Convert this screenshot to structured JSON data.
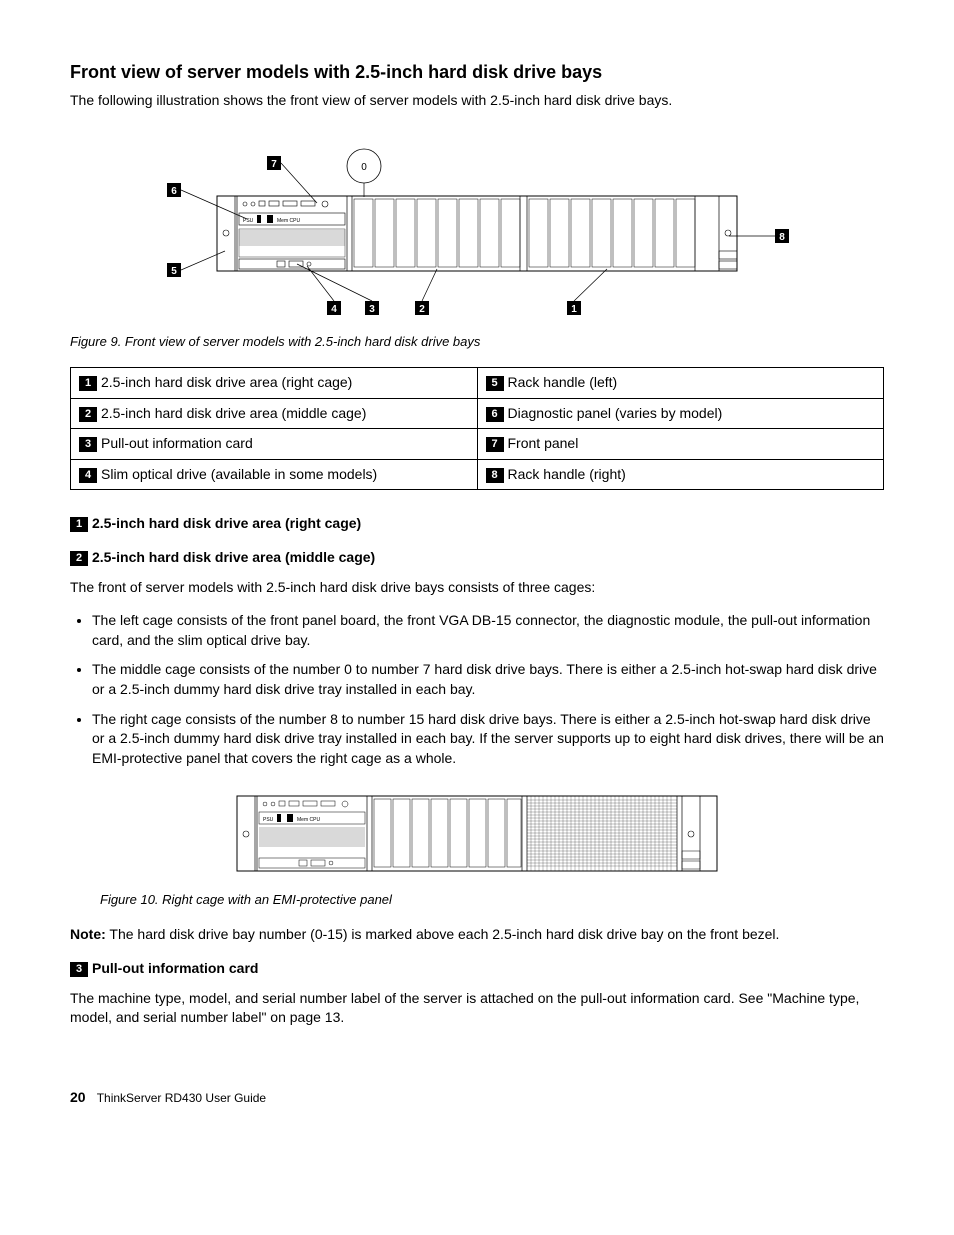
{
  "heading": "Front view of server models with 2.5-inch hard disk drive bays",
  "intro": "The following illustration shows the front view of server models with 2.5-inch hard disk drive bays.",
  "figure9_caption": "Figure 9.  Front view of server models with 2.5-inch hard disk drive bays",
  "callouts_fig9": [
    "7",
    "6",
    "5",
    "4",
    "3",
    "2",
    "1",
    "8"
  ],
  "drive_label_zero": "0",
  "table": {
    "r1c1_num": "1",
    "r1c1_txt": "2.5-inch hard disk drive area (right cage)",
    "r1c2_num": "5",
    "r1c2_txt": "Rack handle (left)",
    "r2c1_num": "2",
    "r2c1_txt": "2.5-inch hard disk drive area (middle cage)",
    "r2c2_num": "6",
    "r2c2_txt": "Diagnostic panel (varies by model)",
    "r3c1_num": "3",
    "r3c1_txt": "Pull-out information card",
    "r3c2_num": "7",
    "r3c2_txt": "Front panel",
    "r4c1_num": "4",
    "r4c1_txt": "Slim optical drive (available in some models)",
    "r4c2_num": "8",
    "r4c2_txt": "Rack handle (right)"
  },
  "sec1_num": "1",
  "sec1_title": "2.5-inch hard disk drive area (right cage)",
  "sec2_num": "2",
  "sec2_title": "2.5-inch hard disk drive area (middle cage)",
  "cages_intro": "The front of server models with 2.5-inch hard disk drive bays consists of three cages:",
  "bullets": {
    "b1": "The left cage consists of the front panel board, the front VGA DB-15 connector, the diagnostic module, the pull-out information card, and the slim optical drive bay.",
    "b2": "The middle cage consists of the number 0 to number 7 hard disk drive bays. There is either a 2.5-inch hot-swap hard disk drive or a 2.5-inch dummy hard disk drive tray installed in each bay.",
    "b3": "The right cage consists of the number 8 to number 15 hard disk drive bays. There is either a 2.5-inch hot-swap hard disk drive or a 2.5-inch dummy hard disk drive tray installed in each bay. If the server supports up to eight hard disk drives, there will be an EMI-protective panel that covers the right cage as a whole."
  },
  "figure10_caption": "Figure 10.  Right cage with an EMI-protective panel",
  "note_label": "Note:",
  "note_text": " The hard disk drive bay number (0-15) is marked above each 2.5-inch hard disk drive bay on the front bezel.",
  "sec3_num": "3",
  "sec3_title": "Pull-out information card",
  "sec3_body": "The machine type, model, and serial number label of the server is attached on the pull-out information card. See \"Machine type, model, and serial number label\" on page 13.",
  "footer_page": "20",
  "footer_text": "ThinkServer RD430 User Guide"
}
